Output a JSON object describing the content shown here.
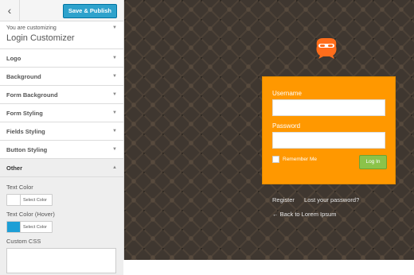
{
  "topbar": {
    "back_icon": "chevron-left-icon",
    "save_label": "Save & Publish"
  },
  "info": {
    "small": "You are customizing",
    "title": "Login Customizer"
  },
  "sections": [
    {
      "label": "Logo"
    },
    {
      "label": "Background"
    },
    {
      "label": "Form Background"
    },
    {
      "label": "Form Styling"
    },
    {
      "label": "Fields Styling"
    },
    {
      "label": "Button Styling"
    },
    {
      "label": "Other"
    }
  ],
  "other": {
    "text_color_label": "Text Color",
    "text_color_button": "Select Color",
    "text_color_value": "#ffffff",
    "hover_color_label": "Text Color (Hover)",
    "hover_color_button": "Select Color",
    "hover_color_value": "#1e9fd6",
    "custom_css_label": "Custom CSS"
  },
  "login": {
    "username_label": "Username",
    "password_label": "Password",
    "remember_label": "Remember Me",
    "login_button": "Log In",
    "register_link": "Register",
    "lost_password_link": "Lost your password?",
    "back_link": "← Back to Lorem Ipsum",
    "box_color": "#ff9800",
    "button_color": "#8bc34a",
    "logo_color": "#ff6d1b"
  }
}
